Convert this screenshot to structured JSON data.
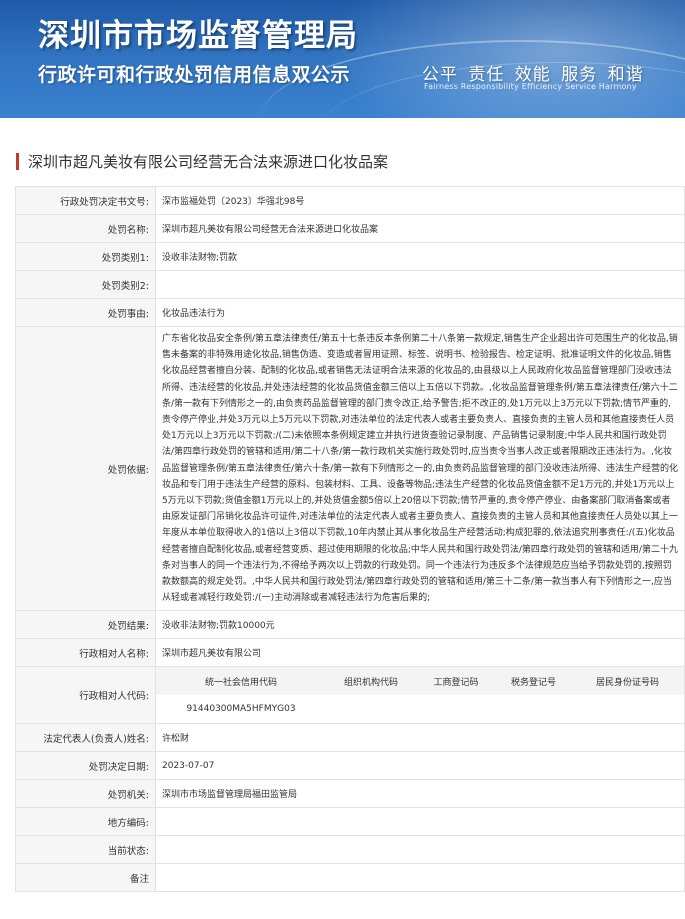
{
  "banner": {
    "title": "深圳市市场监督管理局",
    "subtitle": "行政许可和行政处罚信用信息双公示",
    "motto": "公平 责任 效能 服务 和谐",
    "motto_en": "Fairness Responsibility Efficiency Service Harmony"
  },
  "case": {
    "title": "深圳市超凡美妆有限公司经营无合法来源进口化妆品案"
  },
  "rows": {
    "decision_no": {
      "label": "行政处罚决定书文号:",
      "value": "深市监福处罚〔2023〕华强北98号"
    },
    "case_name": {
      "label": "处罚名称:",
      "value": "深圳市超凡美妆有限公司经营无合法来源进口化妆品案"
    },
    "category1": {
      "label": "处罚类别1:",
      "value": "没收非法财物;罚款"
    },
    "category2": {
      "label": "处罚类别2:",
      "value": ""
    },
    "reason": {
      "label": "处罚事由:",
      "value": "化妆品违法行为"
    },
    "basis": {
      "label": "处罚依据:",
      "value": "广东省化妆品安全条例/第五章法律责任/第五十七条违反本条例第二十八条第一款规定,销售生产企业超出许可范围生产的化妆品,销售未备案的非特殊用途化妆品,销售伪造、变造或者冒用证照、标签、说明书、检验报告、检定证明、批准证明文件的化妆品,销售化妆品经营者擅自分装、配制的化妆品,或者销售无法证明合法来源的化妆品的,由县级以上人民政府化妆品监督管理部门没收违法所得、违法经营的化妆品,并处违法经营的化妆品货值金额三倍以上五倍以下罚款。,化妆品监督管理条例/第五章法律责任/第六十二条/第一款有下列情形之一的,由负责药品监督管理的部门责令改正,给予警告;拒不改正的,处1万元以上3万元以下罚款;情节严重的,责令停产停业,并处3万元以上5万元以下罚款,对违法单位的法定代表人或者主要负责人、直接负责的主管人员和其他直接责任人员处1万元以上3万元以下罚款:/(二)未依照本条例规定建立并执行进货查验记录制度、产品销售记录制度;中华人民共和国行政处罚法/第四章行政处罚的管辖和适用/第二十八条/第一款行政机关实施行政处罚时,应当责令当事人改正或者限期改正违法行为。,化妆品监督管理条例/第五章法律责任/第六十条/第一款有下列情形之一的,由负责药品监督管理的部门没收违法所得、违法生产经营的化妆品和专门用于违法生产经营的原料、包装材料、工具、设备等物品;违法生产经营的化妆品货值金额不足1万元的,并处1万元以上5万元以下罚款;货值金额1万元以上的,并处货值金额5倍以上20倍以下罚款;情节严重的,责令停产停业、由备案部门取消备案或者由原发证部门吊销化妆品许可证件,对违法单位的法定代表人或者主要负责人、直接负责的主管人员和其他直接责任人员处以其上一年度从本单位取得收入的1倍以上3倍以下罚款,10年内禁止其从事化妆品生产经营活动;构成犯罪的,依法追究刑事责任:/(五)化妆品经营者擅自配制化妆品,或者经营变质、超过使用期限的化妆品;中华人民共和国行政处罚法/第四章行政处罚的管辖和适用/第二十九条对当事人的同一个违法行为,不得给予两次以上罚款的行政处罚。同一个违法行为违反多个法律规范应当给予罚款处罚的,按照罚款数额高的规定处罚。,中华人民共和国行政处罚法/第四章行政处罚的管辖和适用/第三十二条/第一款当事人有下列情形之一,应当从轻或者减轻行政处罚:/(一)主动消除或者减轻违法行为危害后果的;"
    },
    "result": {
      "label": "处罚结果:",
      "value": "没收非法财物;罚款10000元"
    },
    "counterpart_name": {
      "label": "行政相对人名称:",
      "value": "深圳市超凡美妆有限公司"
    },
    "counterpart_code": {
      "label": "行政相对人代码:",
      "headers": [
        "统一社会信用代码",
        "组织机构代码",
        "工商登记码",
        "税务登记号",
        "居民身份证号码"
      ],
      "values": [
        "91440300MA5HFMYG03",
        "",
        "",
        "",
        ""
      ]
    },
    "legal_rep": {
      "label": "法定代表人(负责人)姓名:",
      "value": "许松财"
    },
    "decision_date": {
      "label": "处罚决定日期:",
      "value": "2023-07-07"
    },
    "authority": {
      "label": "处罚机关:",
      "value": "深圳市市场监督管理局福田监管局"
    },
    "local_code": {
      "label": "地方编码:",
      "value": ""
    },
    "status": {
      "label": "当前状态:",
      "value": ""
    },
    "remark": {
      "label": "备注",
      "value": ""
    }
  },
  "colors": {
    "banner_top": "#1f5aa8",
    "banner_bottom": "#3b82cf",
    "accent_bar": "#c0392b",
    "label_bg": "#f6f6f6",
    "border": "#e3e3e3"
  }
}
